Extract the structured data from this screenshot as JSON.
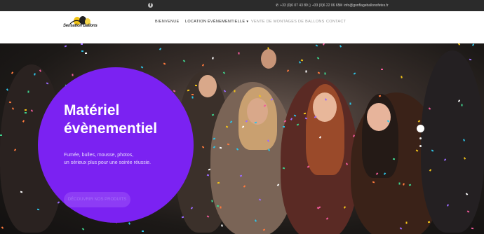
{
  "topbar": {
    "facebook_icon": "facebook-icon",
    "phone_1": "+33 (0)6 07 43 89",
    "phone_2": "+33 (0)6 22 06 65",
    "email": "info@gonflageballonsfetes.fr"
  },
  "nav": {
    "logo_text": "Sensation Ballons",
    "items": [
      {
        "label": "BIENVENUE"
      },
      {
        "label": "LOCATION ÉVÈNEMENTIELLE"
      },
      {
        "label": "VENTE DE MONTAGES DE BALLONS"
      },
      {
        "label": "CONTACT"
      }
    ]
  },
  "hero": {
    "title": "Matériel évènementiel",
    "subtitle_1": "Fumée, bulles, mousse, photos,",
    "subtitle_2": "un sérieux plus pour une soirée réussie.",
    "button_label": "DÉCOUVRIR NOS PRODUITS",
    "accent_color": "#7b22f2"
  },
  "slider": {
    "active_index": 1,
    "count": 3
  }
}
